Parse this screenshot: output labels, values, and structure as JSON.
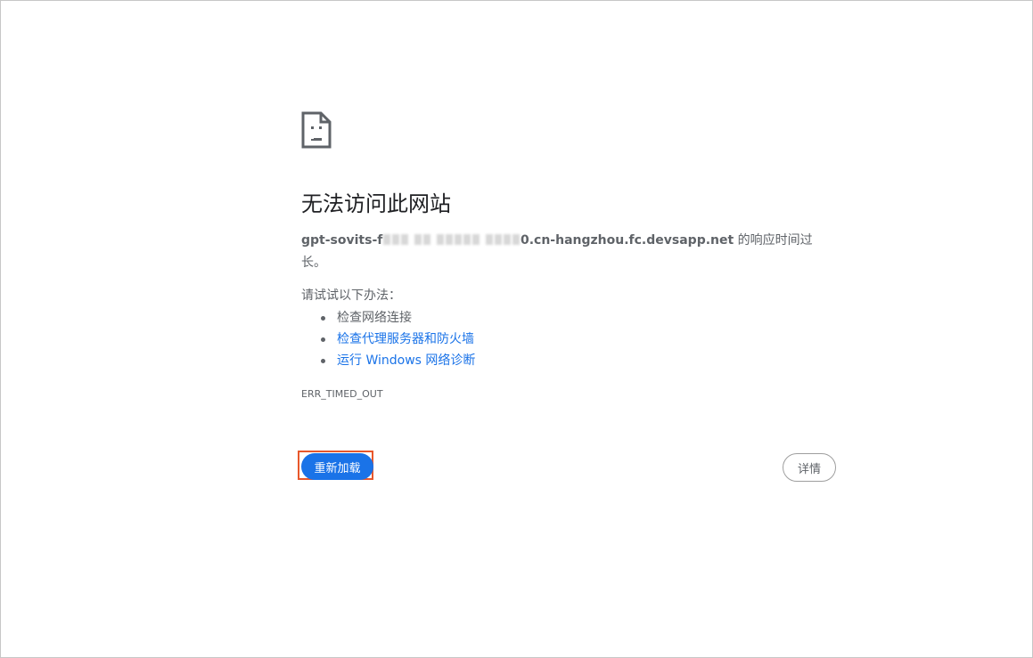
{
  "error": {
    "icon": "sad-page-icon",
    "title": "无法访问此网站",
    "host_prefix": "gpt-sovits-f",
    "host_suffix": "0.cn-hangzhou.fc.devsapp.net",
    "message_tail": " 的响应时间过长。",
    "suggestions_heading": "请试试以下办法：",
    "suggestions": [
      {
        "label": "检查网络连接",
        "is_link": false
      },
      {
        "label": "检查代理服务器和防火墙",
        "is_link": true
      },
      {
        "label": "运行 Windows 网络诊断",
        "is_link": true
      }
    ],
    "code": "ERR_TIMED_OUT"
  },
  "buttons": {
    "reload_label": "重新加载",
    "details_label": "详情"
  },
  "colors": {
    "accent": "#1a73e8",
    "text_secondary": "#5f6368",
    "highlight_border": "#e8572b"
  }
}
